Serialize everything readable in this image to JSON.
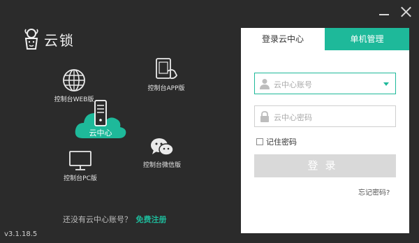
{
  "app": {
    "logo_text": "云锁",
    "version": "v3.1.18.5"
  },
  "features": {
    "web_label": "控制台WEB版",
    "app_label": "控制台APP版",
    "cloud_label": "云中心",
    "pc_label": "控制台PC版",
    "wechat_label": "控制台微信版"
  },
  "register": {
    "prompt": "还没有云中心账号？",
    "link": "免费注册"
  },
  "login": {
    "tabs": [
      {
        "label": "登录云中心",
        "active": true
      },
      {
        "label": "单机管理",
        "active": false
      }
    ],
    "account_placeholder": "云中心账号",
    "password_placeholder": "云中心密码",
    "remember_label": "记住密码",
    "remember_checked": false,
    "submit_label": "登录",
    "forgot_label": "忘记密码?"
  },
  "colors": {
    "accent": "#1eb99a",
    "background": "#2b2b2b",
    "panel": "#ffffff",
    "button_disabled": "#d9d9d9"
  },
  "icons": {
    "minimize": "minimize-icon",
    "close": "close-icon",
    "logo": "lion-logo-icon",
    "web": "globe-icon",
    "app": "tablet-hand-icon",
    "cloud": "cloud-server-icon",
    "pc": "monitor-icon",
    "wechat": "wechat-icon",
    "user": "user-icon",
    "lock": "lock-icon",
    "dropdown": "caret-down-icon"
  }
}
